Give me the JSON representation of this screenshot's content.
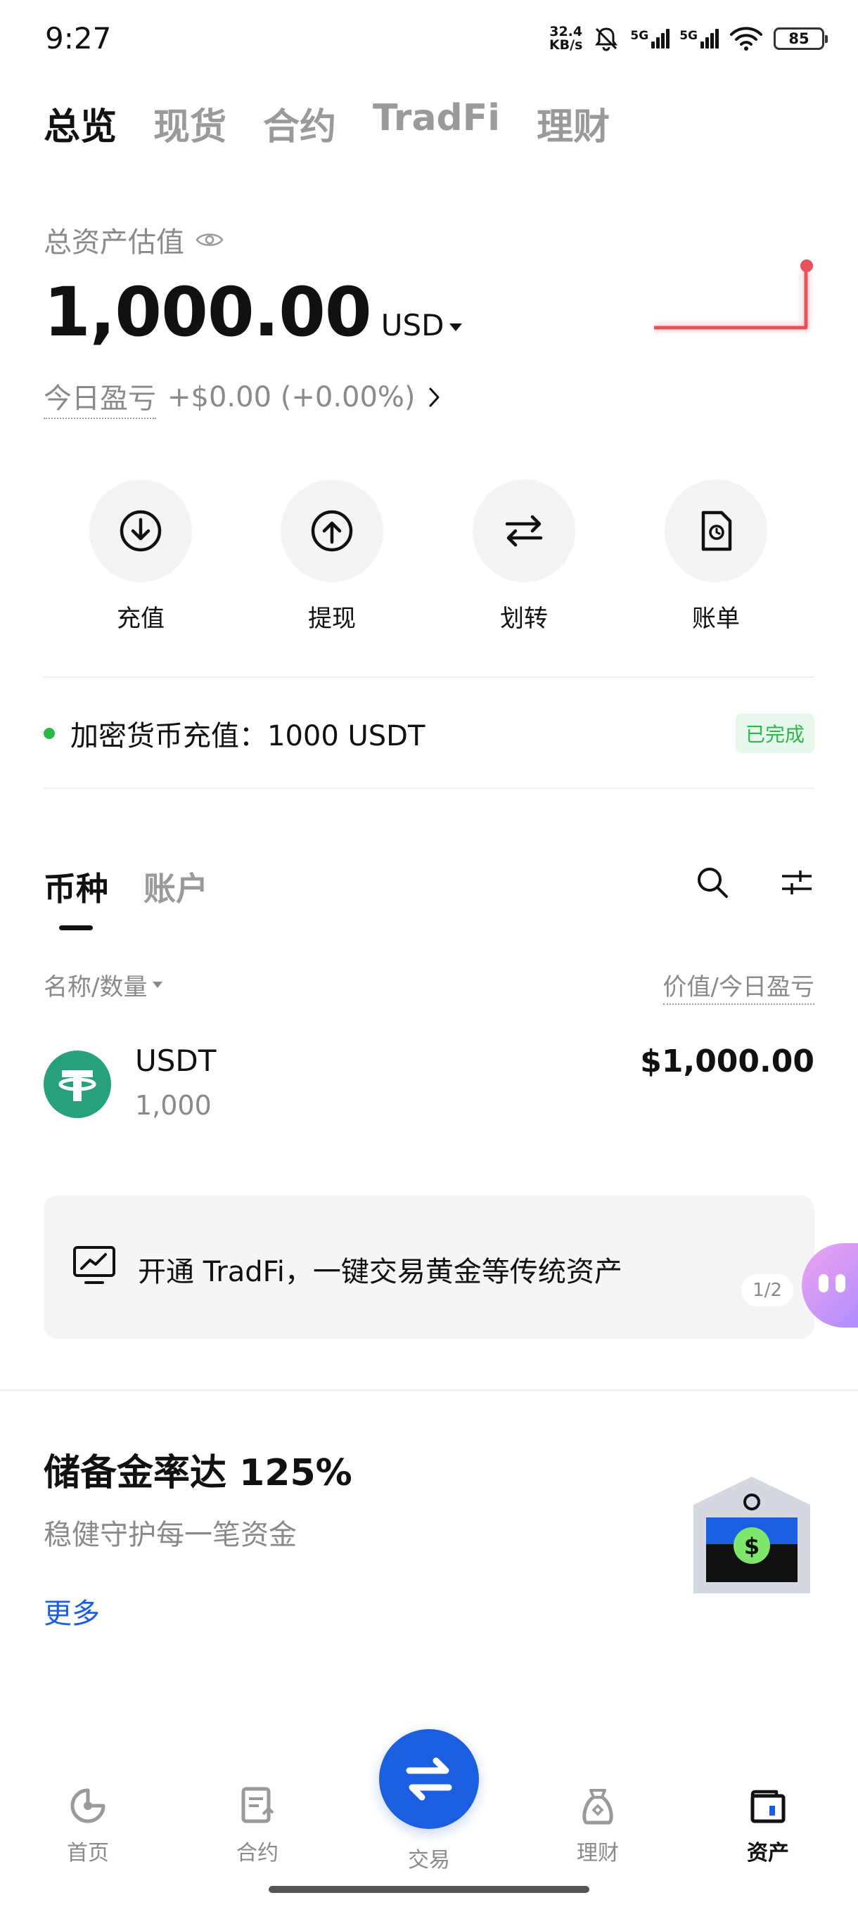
{
  "status_bar": {
    "time": "9:27",
    "net_speed": "32.4",
    "net_speed_unit": "KB/s",
    "signal1_label": "5G",
    "signal2_label": "5G",
    "battery": "85"
  },
  "top_tabs": [
    {
      "label": "总览",
      "active": true
    },
    {
      "label": "现货",
      "active": false
    },
    {
      "label": "合约",
      "active": false
    },
    {
      "label": "TradFi",
      "active": false
    },
    {
      "label": "理财",
      "active": false
    }
  ],
  "overview": {
    "total_label": "总资产估值",
    "amount": "1,000.00",
    "currency": "USD",
    "pnl_label": "今日盈亏",
    "pnl_value": "+$0.00 (+0.00%)",
    "sparkline_color": "#e8505b"
  },
  "actions": [
    {
      "label": "充值",
      "icon": "deposit-icon"
    },
    {
      "label": "提现",
      "icon": "withdraw-icon"
    },
    {
      "label": "划转",
      "icon": "transfer-icon"
    },
    {
      "label": "账单",
      "icon": "bill-icon"
    }
  ],
  "notice": {
    "text": "加密货币充值：1000 USDT",
    "status": "已完成",
    "status_color": "#2bb84a"
  },
  "asset_tabs": [
    {
      "label": "币种",
      "active": true
    },
    {
      "label": "账户",
      "active": false
    }
  ],
  "list_header": {
    "left": "名称/数量",
    "right": "价值/今日盈亏"
  },
  "coins": [
    {
      "symbol": "USDT",
      "quantity": "1,000",
      "value": "$1,000.00",
      "logo_color": "#26a17b"
    }
  ],
  "banner": {
    "text": "开通 TradFi，一键交易黄金等传统资产",
    "page": "1/2"
  },
  "reserve": {
    "title": "储备金率达 125%",
    "subtitle": "稳健守护每一笔资金",
    "more": "更多"
  },
  "bottom_nav": {
    "items": [
      {
        "label": "首页",
        "icon": "home-icon",
        "active": false
      },
      {
        "label": "合约",
        "icon": "contract-icon",
        "active": false
      },
      {
        "label": "交易",
        "icon": "trade-icon",
        "active": false
      },
      {
        "label": "理财",
        "icon": "earn-icon",
        "active": false
      },
      {
        "label": "资产",
        "icon": "assets-icon",
        "active": true
      }
    ],
    "accent": "#1b5fe0"
  }
}
